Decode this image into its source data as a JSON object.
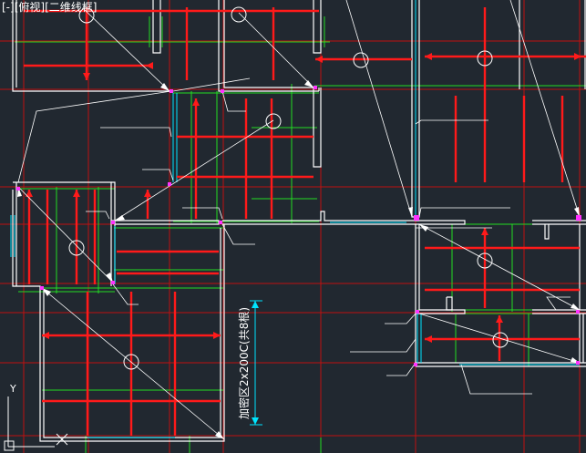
{
  "viewport": {
    "controls": "[-]",
    "view": "[俯视]",
    "visual_style": "[二维线框]"
  },
  "drawing": {
    "annotation": "加密区2x200C(共8根)"
  },
  "ucs": {
    "y_axis_label": "Y",
    "x_marker": "X"
  },
  "colors": {
    "background": "#212830",
    "wall": "#ffffff",
    "rebar": "#ff0000",
    "dimension": "#00ff00",
    "axis": "#cc1111",
    "window": "#00e5ff",
    "node": "#ff00ff",
    "leader": "#ffffff"
  }
}
